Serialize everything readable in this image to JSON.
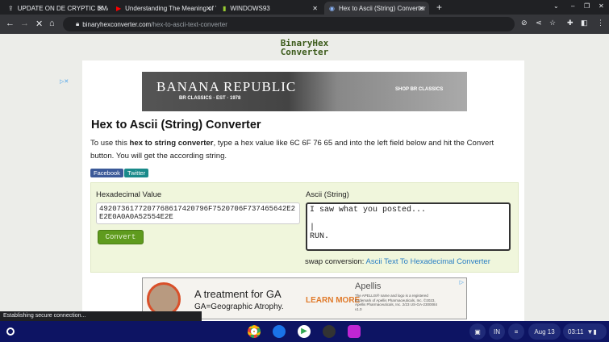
{
  "browser": {
    "tabs": [
      {
        "title": "UPDATE ON DE CRYPTIC EMAIL"
      },
      {
        "title": "Understanding The Meaning of V"
      },
      {
        "title": "WINDOWS93"
      },
      {
        "title": "Hex to Ascii (String) Converter"
      }
    ],
    "url_domain": "binaryhexconverter.com",
    "url_path": "/hex-to-ascii-text-converter",
    "status": "Establishing secure connection..."
  },
  "site": {
    "logo_line1": "BinaryHex",
    "logo_line2": "Converter"
  },
  "ad_top": {
    "brand": "BANANA REPUBLIC",
    "sub": "BR CLASSICS  ·  EST · 1978",
    "cta": "SHOP BR CLASSICS"
  },
  "page": {
    "title": "Hex to Ascii (String) Converter",
    "desc_pre": "To use this ",
    "desc_bold": "hex to string converter",
    "desc_post": ", type a hex value like 6C 6F 76 65 and into the left field below and hit the Convert button. You will get the according string.",
    "facebook": "Facebook",
    "twitter": "Twitter",
    "hex_label": "Hexadecimal Value",
    "hex_value": "4920736177207768617420796F7520706F737465642E2E2E0A0A0A52554E2E",
    "convert": "Convert",
    "ascii_label": "Ascii (String)",
    "ascii_value": "I saw what you posted...\n\n|\nRUN.",
    "swap_label": "swap conversion: ",
    "swap_link": "Ascii Text To Hexadecimal Converter"
  },
  "ad_bottom": {
    "headline": "A treatment for GA",
    "sub": "GA=Geographic Atrophy.",
    "cta": "LEARN MORE",
    "brand": "Apellis",
    "fine": "The APELLIS® name and logo is a registered trademark of Apellis Pharmaceuticals, Inc. ©2023, Apellis Pharmaceuticals, Inc. 2/23 US-GA-2300084 v1.0"
  },
  "taskbar": {
    "lang": "IN",
    "date": "Aug 13",
    "time": "03:11"
  }
}
